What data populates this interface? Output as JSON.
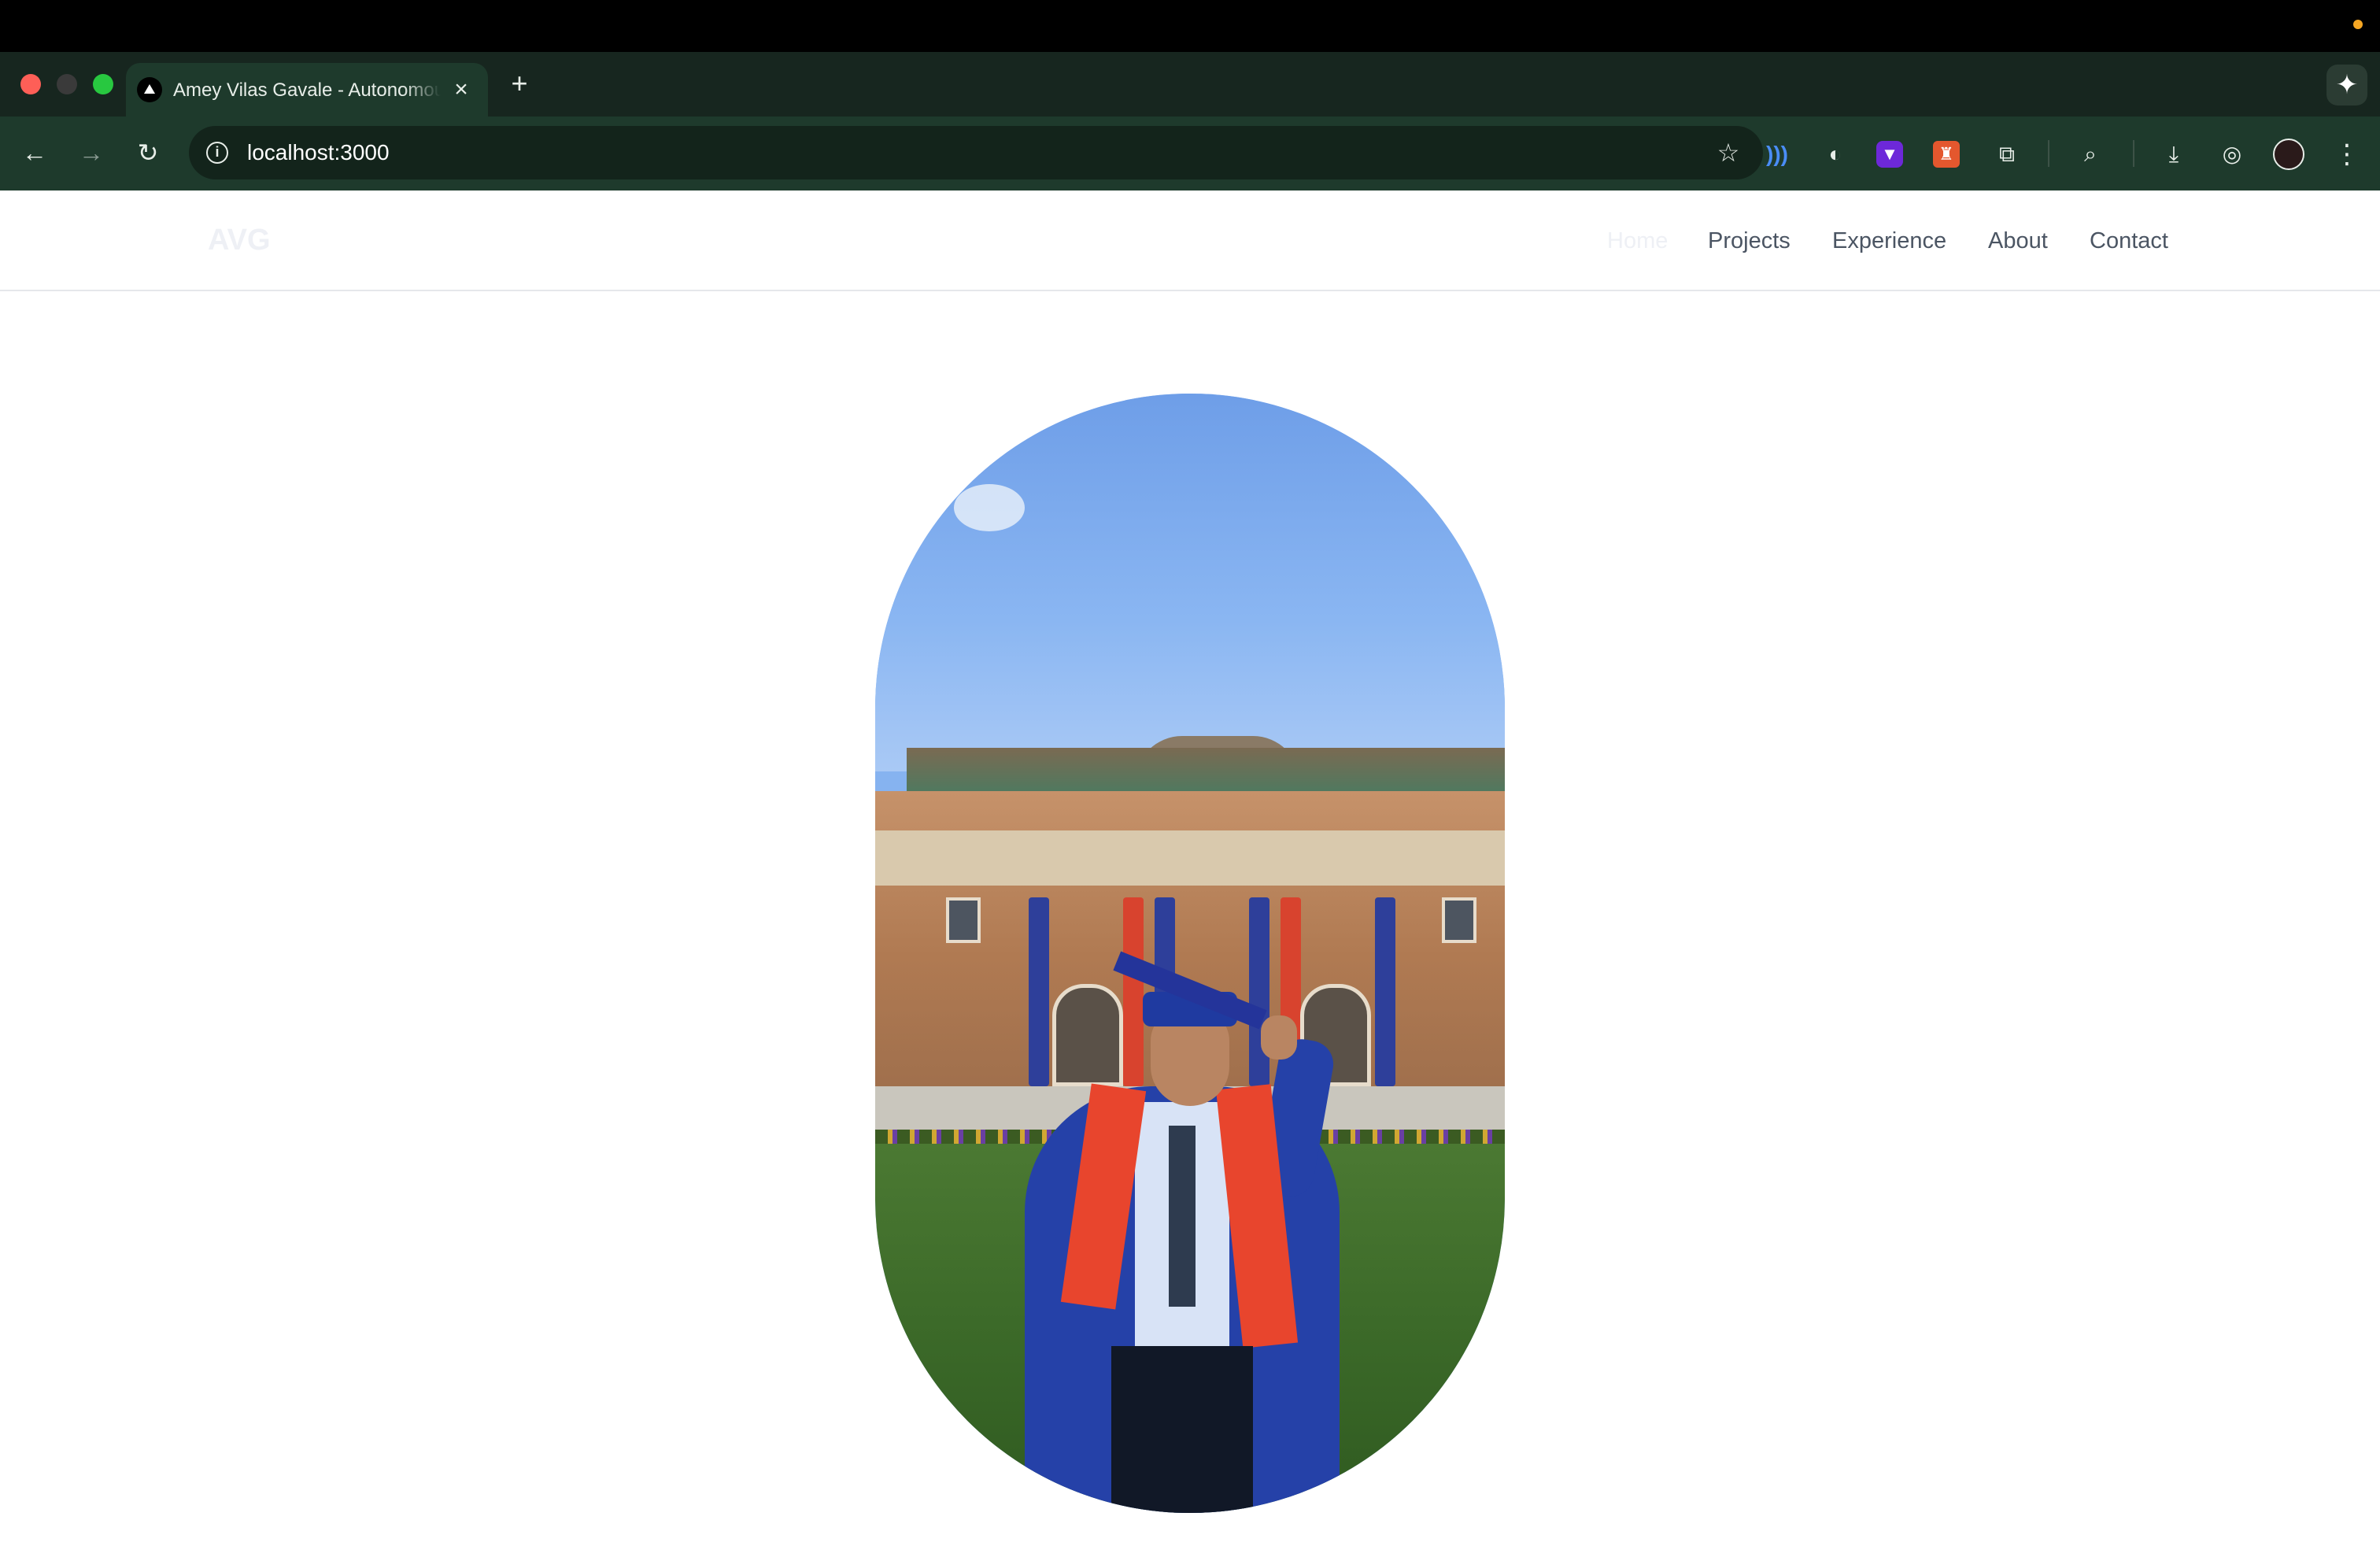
{
  "browser": {
    "tab_title": "Amey Vilas Gavale - Autonomous",
    "tab_close": "×",
    "new_tab": "+",
    "url": "localhost:3000",
    "icons": {
      "back": "arrow-left",
      "forward": "arrow-right",
      "reload": "reload",
      "info": "info",
      "bookmark": "star",
      "gemini": "sparkle",
      "menu": "kebab"
    }
  },
  "site": {
    "logo": "AVG",
    "nav": {
      "home": "Home",
      "projects": "Projects",
      "experience": "Experience",
      "about": "About",
      "contact": "Contact"
    }
  },
  "colors": {
    "browser_frame": "#17261f",
    "toolbar": "#1e3a2c",
    "nav_text": "#4b5563",
    "nav_faded": "#eef0f5"
  }
}
